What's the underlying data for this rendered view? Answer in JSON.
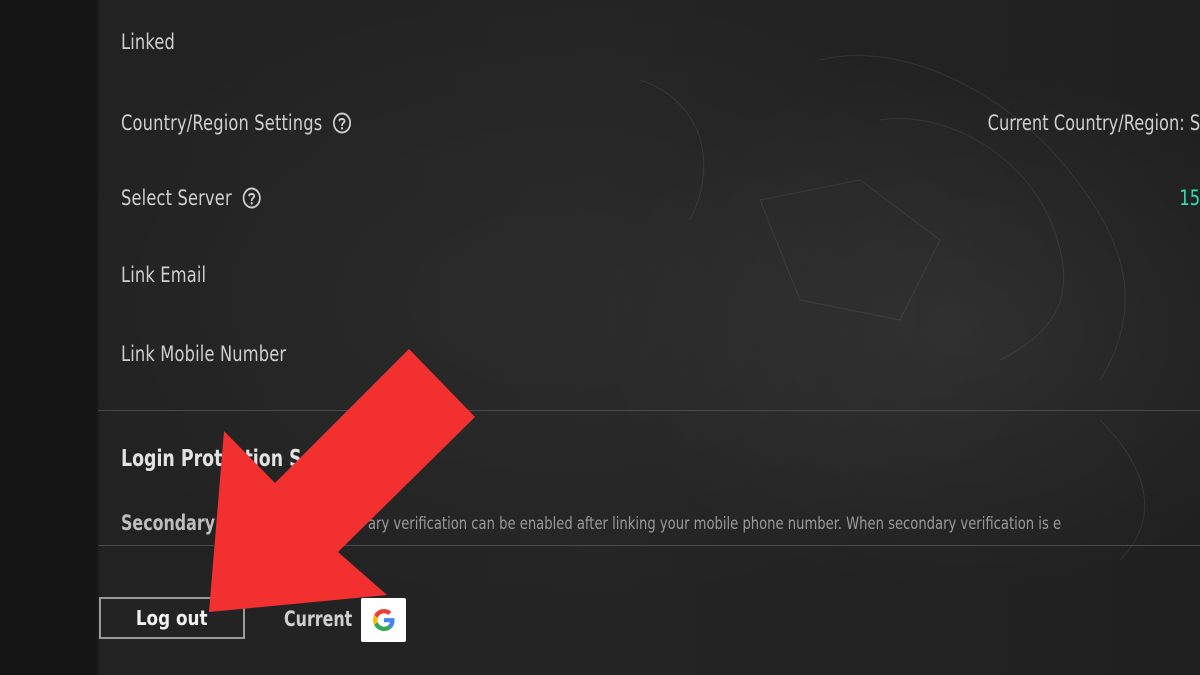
{
  "settings": {
    "linked_label": "Linked",
    "country_label": "Country/Region Settings",
    "country_value": "Current Country/Region: S",
    "server_label": "Select Server",
    "server_value": "15",
    "link_email_label": "Link Email",
    "link_mobile_label": "Link Mobile Number"
  },
  "login_protection": {
    "title": "Login Protection S",
    "secondary_label": "Secondary",
    "secondary_desc": "ary verification can be enabled after linking your mobile phone number. When secondary verification is e"
  },
  "footer": {
    "logout_label": "Log out",
    "current_label": "Current",
    "account_icon": "google-icon"
  },
  "colors": {
    "accent_server": "#2fe0a8",
    "arrow": "#f23030",
    "background": "#1a1a1a"
  }
}
